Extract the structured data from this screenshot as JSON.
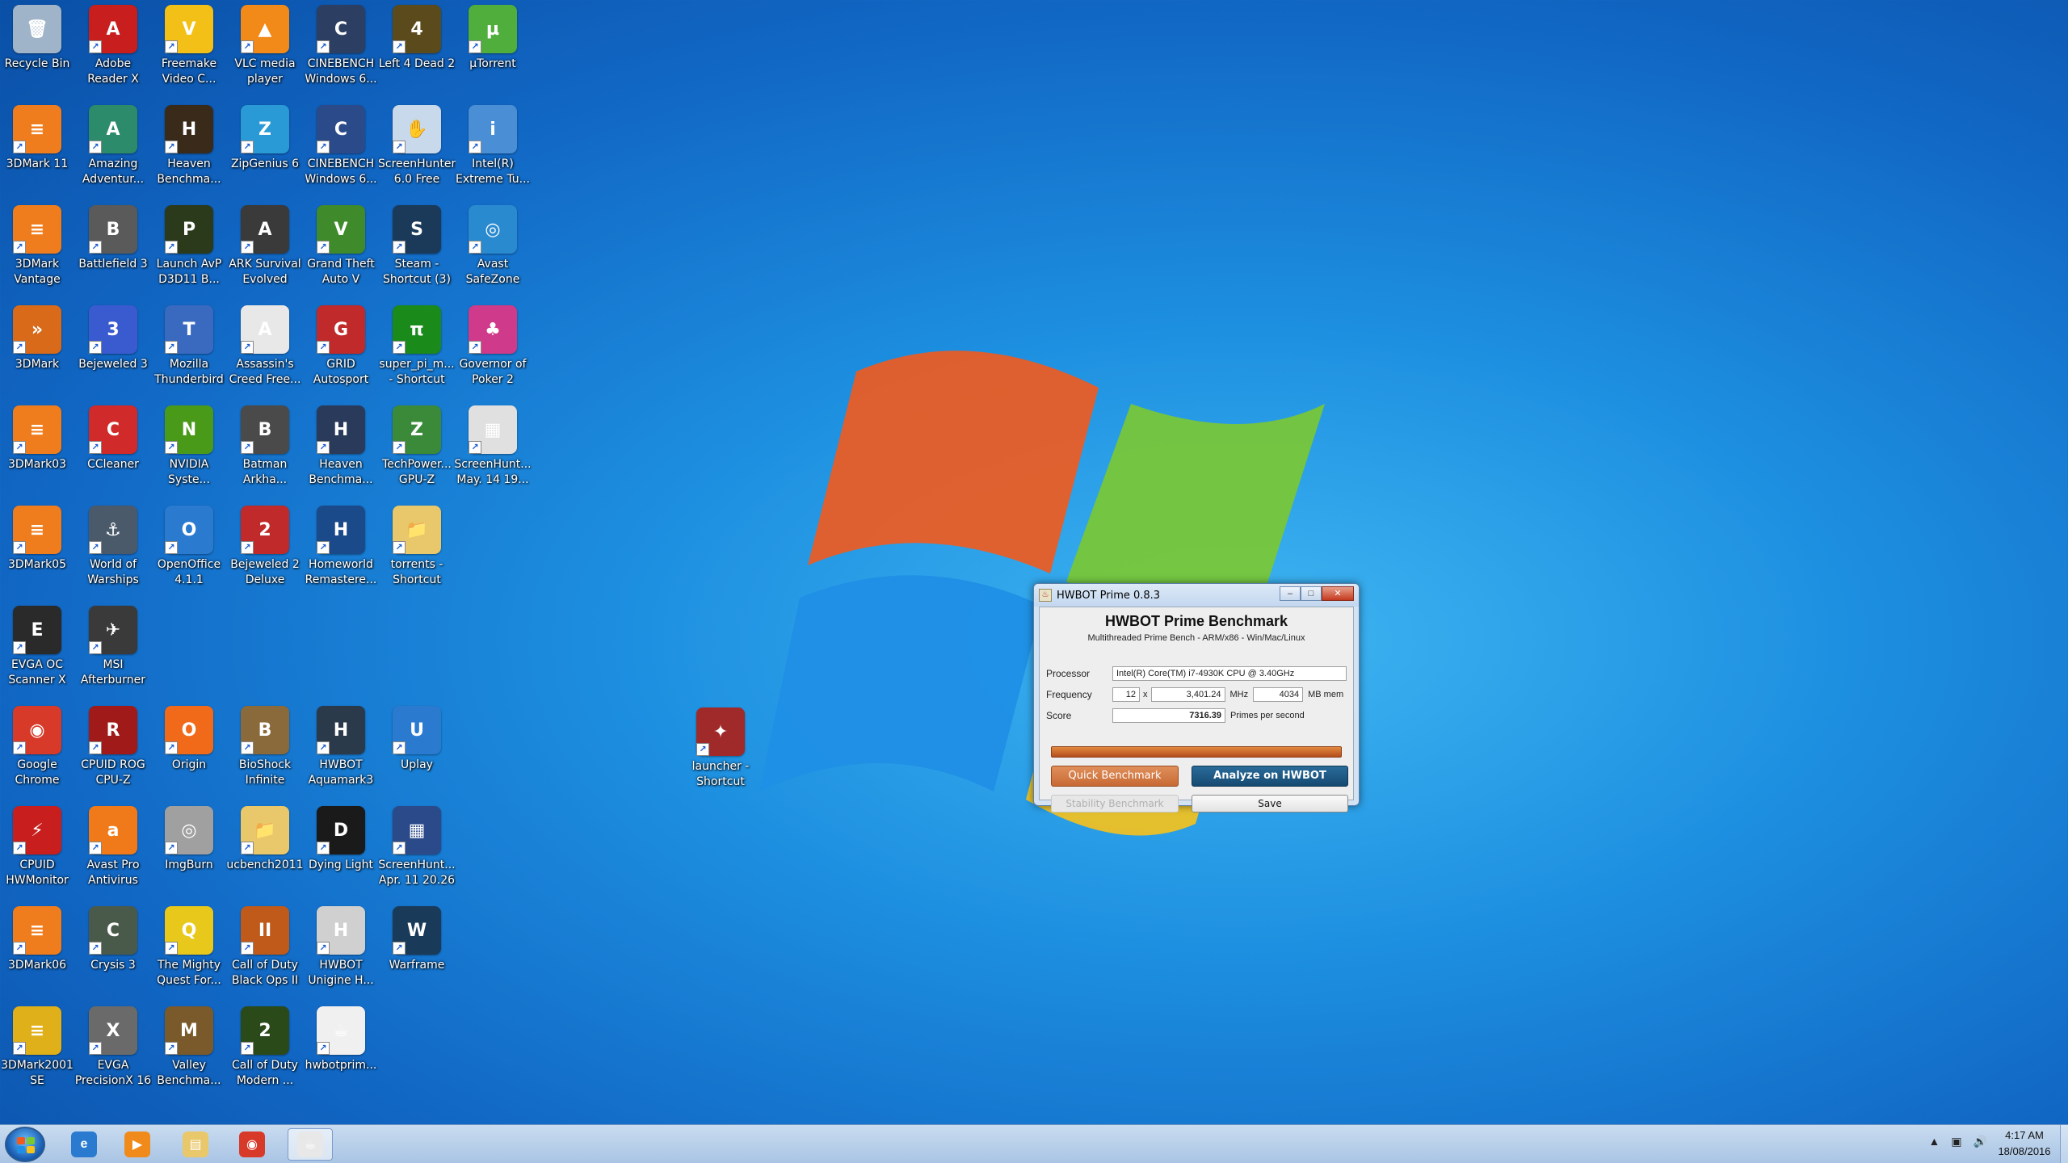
{
  "desktop": {
    "icons": [
      {
        "label": "Recycle Bin",
        "glyph": "🗑",
        "color": "#9fb3c9"
      },
      {
        "label": "Adobe Reader X",
        "glyph": "A",
        "color": "#c81e1e"
      },
      {
        "label": "Freemake Video C...",
        "glyph": "V",
        "color": "#f2c016"
      },
      {
        "label": "VLC media player",
        "glyph": "▲",
        "color": "#f28a1a"
      },
      {
        "label": "CINEBENCH Windows 6...",
        "glyph": "C",
        "color": "#2c3f63"
      },
      {
        "label": "Left 4 Dead 2",
        "glyph": "4",
        "color": "#5a4a1c"
      },
      {
        "label": "µTorrent",
        "glyph": "µ",
        "color": "#4fae3c"
      },
      {
        "label": "3DMark 11",
        "glyph": "≡",
        "color": "#f07d1d"
      },
      {
        "label": "Amazing Adventur...",
        "glyph": "A",
        "color": "#2c8b6a"
      },
      {
        "label": "Heaven Benchma...",
        "glyph": "H",
        "color": "#3a2a1a"
      },
      {
        "label": "ZipGenius 6",
        "glyph": "Z",
        "color": "#2a9ad6"
      },
      {
        "label": "CINEBENCH Windows 6...",
        "glyph": "C",
        "color": "#2a4a8a"
      },
      {
        "label": "ScreenHunter 6.0 Free",
        "glyph": "✋",
        "color": "#c9d9ec"
      },
      {
        "label": "Intel(R) Extreme Tu...",
        "glyph": "i",
        "color": "#4a8fd6"
      },
      {
        "label": "3DMark Vantage",
        "glyph": "≡",
        "color": "#f07d1d"
      },
      {
        "label": "Battlefield 3",
        "glyph": "B",
        "color": "#5a5a5a"
      },
      {
        "label": "Launch AvP D3D11 B...",
        "glyph": "P",
        "color": "#2a3a1a"
      },
      {
        "label": "ARK Survival Evolved",
        "glyph": "A",
        "color": "#3a3a3a"
      },
      {
        "label": "Grand Theft Auto V",
        "glyph": "V",
        "color": "#3f8a2a"
      },
      {
        "label": "Steam - Shortcut (3)",
        "glyph": "S",
        "color": "#1b3a5a"
      },
      {
        "label": "Avast SafeZone",
        "glyph": "◎",
        "color": "#2a8ad0"
      },
      {
        "label": "3DMark",
        "glyph": "»",
        "color": "#d96a1a"
      },
      {
        "label": "Bejeweled 3",
        "glyph": "3",
        "color": "#3a5ad0"
      },
      {
        "label": "Mozilla Thunderbird",
        "glyph": "T",
        "color": "#3a6ac0"
      },
      {
        "label": "Assassin's Creed Free...",
        "glyph": "A",
        "color": "#e8e8e8"
      },
      {
        "label": "GRID Autosport",
        "glyph": "G",
        "color": "#c02a2a"
      },
      {
        "label": "super_pi_m... - Shortcut",
        "glyph": "π",
        "color": "#1a8a1a"
      },
      {
        "label": "Governor of Poker 2",
        "glyph": "♣",
        "color": "#d03a8a"
      },
      {
        "label": "3DMark03",
        "glyph": "≡",
        "color": "#f07d1d"
      },
      {
        "label": "CCleaner",
        "glyph": "C",
        "color": "#d02a2a"
      },
      {
        "label": "NVIDIA Syste...",
        "glyph": "N",
        "color": "#4a9a1a"
      },
      {
        "label": "Batman Arkha...",
        "glyph": "B",
        "color": "#4a4a4a"
      },
      {
        "label": "Heaven Benchma...",
        "glyph": "H",
        "color": "#2a3a5a"
      },
      {
        "label": "TechPower... GPU-Z",
        "glyph": "Z",
        "color": "#3a8a3a"
      },
      {
        "label": "ScreenHunt... May. 14 19...",
        "glyph": "▦",
        "color": "#e0e0e0"
      },
      {
        "label": "3DMark05",
        "glyph": "≡",
        "color": "#f07d1d"
      },
      {
        "label": "World of Warships",
        "glyph": "⚓",
        "color": "#4a5a6a"
      },
      {
        "label": "OpenOffice 4.1.1",
        "glyph": "O",
        "color": "#2a7ad0"
      },
      {
        "label": "Bejeweled 2 Deluxe",
        "glyph": "2",
        "color": "#c02a2a"
      },
      {
        "label": "Homeworld Remastere...",
        "glyph": "H",
        "color": "#1a4a8a"
      },
      {
        "label": "torrents - Shortcut",
        "glyph": "📁",
        "color": "#e8c86a"
      },
      {
        "label": "EVGA OC Scanner X",
        "glyph": "E",
        "color": "#2a2a2a"
      },
      {
        "label": "MSI Afterburner",
        "glyph": "✈",
        "color": "#3a3a3a"
      },
      {
        "label": "Google Chrome",
        "glyph": "◉",
        "color": "#d83a2a"
      },
      {
        "label": "CPUID ROG CPU-Z",
        "glyph": "R",
        "color": "#a01a1a"
      },
      {
        "label": "Origin",
        "glyph": "O",
        "color": "#f06a1a"
      },
      {
        "label": "BioShock Infinite",
        "glyph": "B",
        "color": "#8a6a3a"
      },
      {
        "label": "HWBOT Aquamark3",
        "glyph": "H",
        "color": "#2a3a4a"
      },
      {
        "label": "Uplay",
        "glyph": "U",
        "color": "#2a7ad0"
      },
      {
        "label": "CPUID HWMonitor",
        "glyph": "⚡",
        "color": "#c81e1e"
      },
      {
        "label": "Avast Pro Antivirus",
        "glyph": "a",
        "color": "#f07a1a"
      },
      {
        "label": "ImgBurn",
        "glyph": "◎",
        "color": "#a0a0a0"
      },
      {
        "label": "ucbench2011",
        "glyph": "📁",
        "color": "#e8c86a"
      },
      {
        "label": "Dying Light",
        "glyph": "D",
        "color": "#1a1a1a"
      },
      {
        "label": "ScreenHunt... Apr. 11 20.26",
        "glyph": "▦",
        "color": "#2a4a8a"
      },
      {
        "label": "3DMark06",
        "glyph": "≡",
        "color": "#f07d1d"
      },
      {
        "label": "Crysis 3",
        "glyph": "C",
        "color": "#4a5a4a"
      },
      {
        "label": "The Mighty Quest For...",
        "glyph": "Q",
        "color": "#e8c81a"
      },
      {
        "label": "Call of Duty Black Ops II",
        "glyph": "II",
        "color": "#c05a1a"
      },
      {
        "label": "HWBOT Unigine H...",
        "glyph": "H",
        "color": "#d0d0d0"
      },
      {
        "label": "Warframe",
        "glyph": "W",
        "color": "#1a3a5a"
      },
      {
        "label": "3DMark2001 SE",
        "glyph": "≡",
        "color": "#e0b01a"
      },
      {
        "label": "EVGA PrecisionX 16",
        "glyph": "X",
        "color": "#6a6a6a"
      },
      {
        "label": "Valley Benchma...",
        "glyph": "M",
        "color": "#7a5a2a"
      },
      {
        "label": "Call of Duty Modern ...",
        "glyph": "2",
        "color": "#2a4a1a"
      },
      {
        "label": "hwbotprim...",
        "glyph": "☕",
        "color": "#f0f0f0"
      },
      {
        "label": "launcher - Shortcut",
        "glyph": "✦",
        "color": "#a02a2a"
      }
    ]
  },
  "hwbot": {
    "window_title": "HWBOT Prime 0.8.3",
    "heading": "HWBOT Prime Benchmark",
    "subheading": "Multithreaded Prime Bench - ARM/x86 - Win/Mac/Linux",
    "processor_label": "Processor",
    "processor_value": "Intel(R) Core(TM) i7-4930K CPU @ 3.40GHz",
    "frequency_label": "Frequency",
    "multiplier": "12",
    "times": "x",
    "frequency_value": "3,401.24",
    "frequency_unit": "MHz",
    "memory_value": "4034",
    "memory_unit": "MB mem",
    "score_label": "Score",
    "score_value": "7316.39",
    "score_unit": "Primes per second",
    "progress_fraction": 1.0,
    "quick_button": "Quick Benchmark",
    "analyze_button": "Analyze on HWBOT",
    "stability_button": "Stability Benchmark",
    "save_button": "Save",
    "minimize": "–",
    "maximize": "□",
    "close": "✕"
  },
  "taskbar": {
    "apps": [
      {
        "name": "internet-explorer",
        "glyph": "e",
        "color": "#2a7ad0"
      },
      {
        "name": "media-player",
        "glyph": "▶",
        "color": "#f08a1a"
      },
      {
        "name": "file-explorer",
        "glyph": "▤",
        "color": "#e8c86a"
      },
      {
        "name": "google-chrome",
        "glyph": "◉",
        "color": "#d83a2a"
      },
      {
        "name": "java-hwbot",
        "glyph": "☕",
        "color": "#e8e8e8"
      }
    ],
    "tray": {
      "up_arrow": "▲",
      "network": "▣",
      "volume": "🔊"
    },
    "clock": {
      "time": "4:17 AM",
      "date": "18/08/2016"
    }
  },
  "colors": {
    "accent_orange": "#c86a34",
    "accent_blue": "#154a72"
  }
}
